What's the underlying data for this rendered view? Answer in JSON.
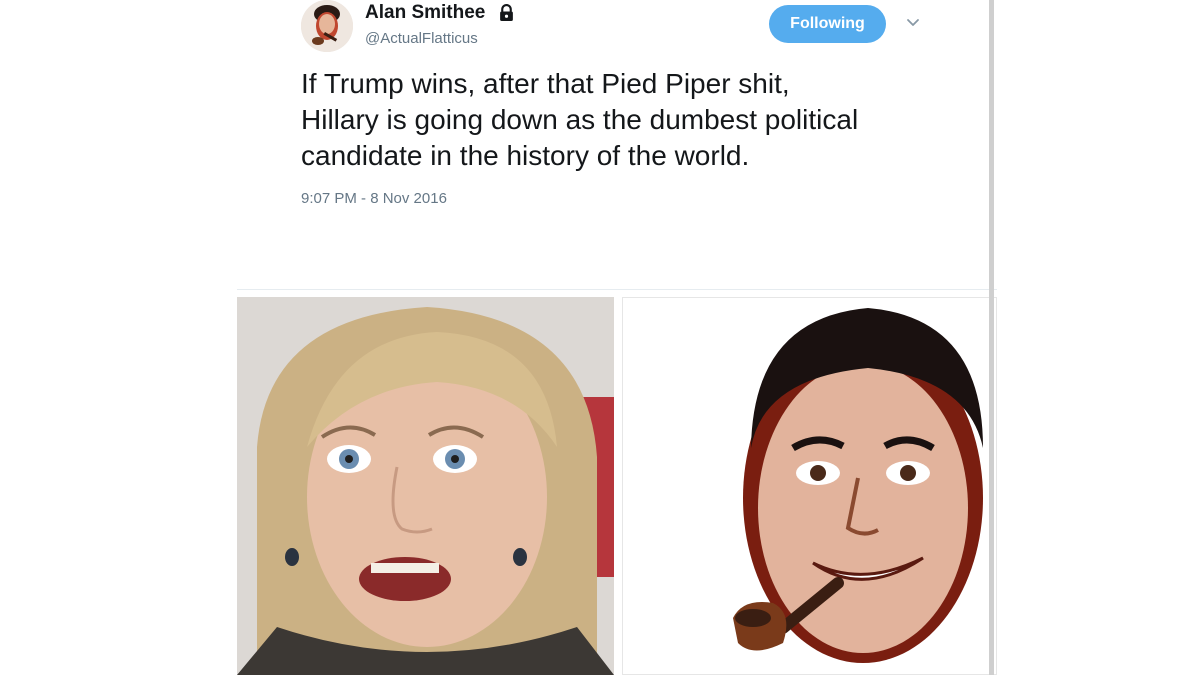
{
  "tweet": {
    "display_name": "Alan Smithee",
    "handle": "@ActualFlatticus",
    "follow_button_label": "Following",
    "text_lines": [
      "If Trump wins, after that Pied Piper shit,",
      "Hillary is going down as the dumbest political",
      "candidate in the history of the world."
    ],
    "timestamp": "9:07 PM - 8 Nov 2016"
  },
  "icons": {
    "lock": "lock-icon",
    "caret": "chevron-down-icon"
  },
  "colors": {
    "follow_button": "#55acee",
    "secondary_text": "#657786",
    "primary_text": "#14171a"
  }
}
